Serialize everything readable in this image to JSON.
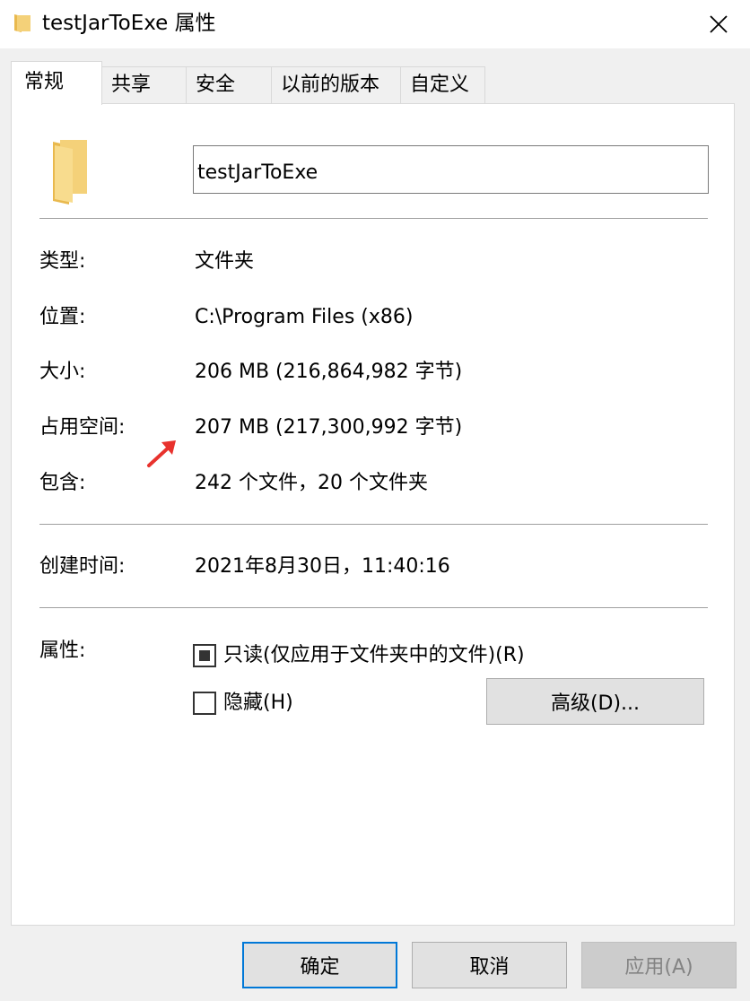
{
  "window": {
    "title": "testJarToExe 属性"
  },
  "tabs": [
    {
      "label": "常规",
      "active": true
    },
    {
      "label": "共享",
      "active": false
    },
    {
      "label": "安全",
      "active": false
    },
    {
      "label": "以前的版本",
      "active": false
    },
    {
      "label": "自定义",
      "active": false
    }
  ],
  "general": {
    "name_value": "testJarToExe",
    "type_label": "类型:",
    "type_value": "文件夹",
    "location_label": "位置:",
    "location_value": "C:\\Program Files (x86)",
    "size_label": "大小:",
    "size_value": "206 MB (216,864,982 字节)",
    "disk_label": "占用空间:",
    "disk_value": "207 MB (217,300,992 字节)",
    "contains_label": "包含:",
    "contains_value": "242 个文件，20 个文件夹",
    "created_label": "创建时间:",
    "created_value": "2021年8月30日，11:40:16",
    "attributes_label": "属性:",
    "readonly_label": "只读(仅应用于文件夹中的文件)(R)",
    "readonly_state": "indeterminate",
    "hidden_label": "隐藏(H)",
    "hidden_checked": false,
    "advanced_label": "高级(D)..."
  },
  "footer": {
    "ok_label": "确定",
    "cancel_label": "取消",
    "apply_label": "应用(A)"
  },
  "icons": {
    "title": "folder-icon",
    "close": "close-icon",
    "folder_big": "folder-icon",
    "annotation": "red-arrow-icon"
  },
  "colors": {
    "folder": "#f4d179",
    "default_button_border": "#0078d7",
    "annotation_arrow": "#e8322d"
  }
}
